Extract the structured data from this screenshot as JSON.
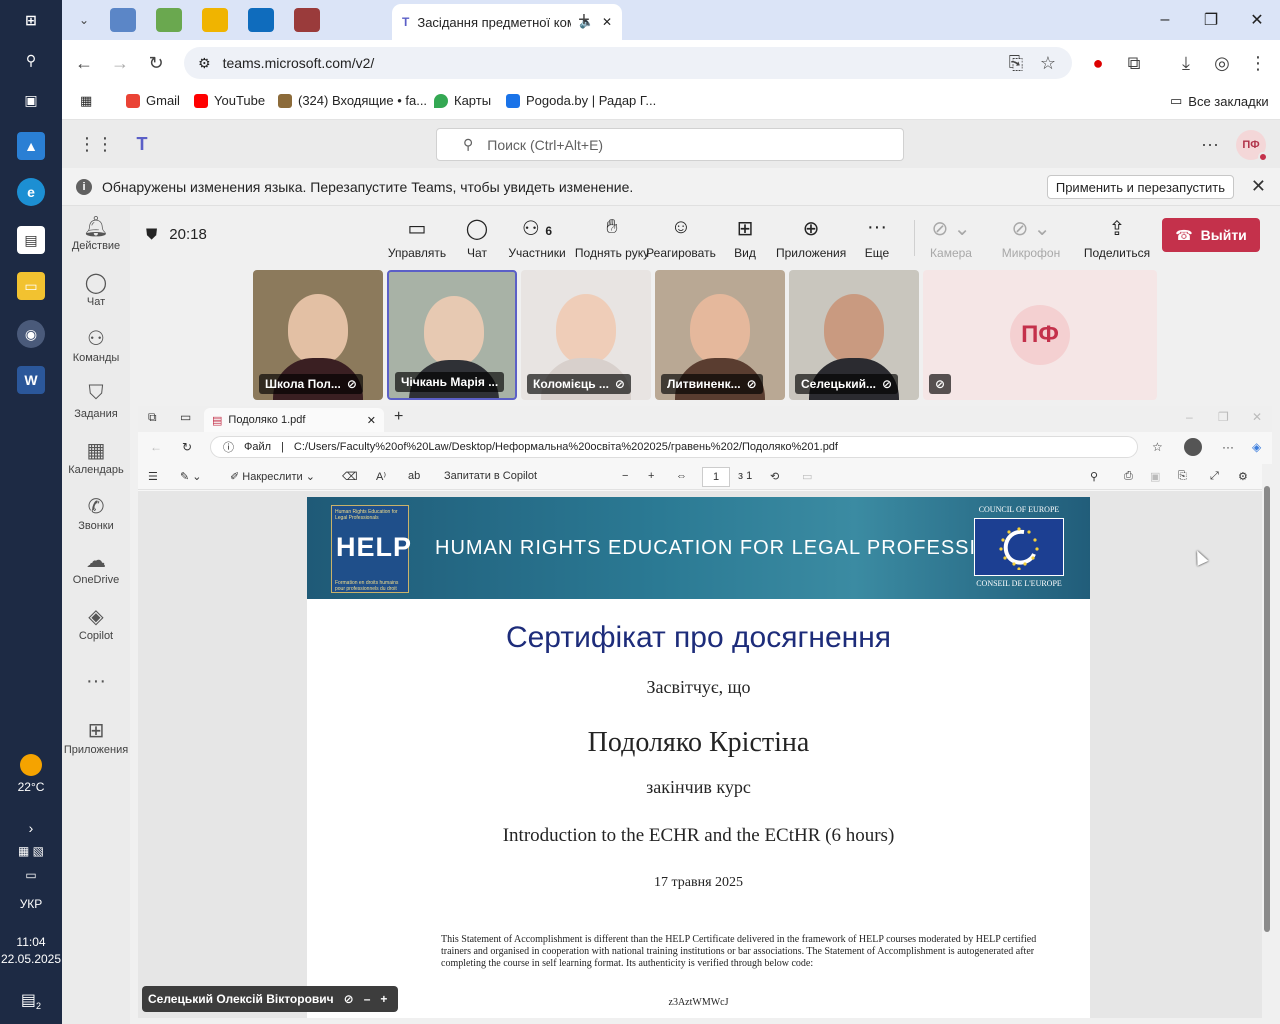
{
  "taskbar": {
    "weather_temp": "22°C",
    "language": "УКР",
    "time": "11:04",
    "date": "22.05.2025",
    "notifications_count": "2"
  },
  "chrome": {
    "active_tab_title": "Засідання предметної ком",
    "url": "teams.microsoft.com/v2/",
    "bookmarks": [
      {
        "label": "Gmail",
        "color": "#ea4335"
      },
      {
        "label": "YouTube",
        "color": "#ff0000"
      },
      {
        "label": "(324) Входящие • fa...",
        "color": "#8c6b3a"
      },
      {
        "label": "Карты",
        "color": "#34a853"
      },
      {
        "label": "Pogoda.by | Радар Г...",
        "color": "#1a73e8"
      }
    ],
    "all_bookmarks": "Все закладки"
  },
  "teams": {
    "search_placeholder": "Поиск (Ctrl+Alt+E)",
    "avatar_initials": "ПФ",
    "notice_text": "Обнаружены изменения языка. Перезапустите Teams, чтобы увидеть изменение.",
    "notice_button": "Применить и перезапустить",
    "rail": [
      "Действие",
      "Чат",
      "Команды",
      "Задания",
      "Календарь",
      "Звонки",
      "OneDrive",
      "Copilot",
      "Приложения"
    ]
  },
  "meeting": {
    "timer": "20:18",
    "controls": {
      "manage": "Управлять",
      "chat": "Чат",
      "participants": "Участники",
      "participants_count": "6",
      "raise_hand": "Поднять руку",
      "react": "Реагировать",
      "view": "Вид",
      "apps": "Приложения",
      "more": "Еще",
      "camera": "Камера",
      "mic": "Микрофон",
      "share": "Поделиться",
      "leave": "Выйти"
    },
    "participants": [
      {
        "name": "Школа Пол...",
        "bg": "#8c7a5c"
      },
      {
        "name": "Чічкань Марія ...",
        "bg": "#a8b2a6"
      },
      {
        "name": "Коломієць ...",
        "bg": "#e8e4e2"
      },
      {
        "name": "Литвиненк...",
        "bg": "#b9a894"
      },
      {
        "name": "Селецький...",
        "bg": "#c9c6be"
      }
    ],
    "avatar_tile_initials": "ПФ",
    "self_name": "Селецький Олексій Вікторович"
  },
  "pdf": {
    "tab_title": "Подоляко 1.pdf",
    "file_label": "Файл",
    "path": "C:/Users/Faculty%20of%20Law/Desktop/Неформальна%20освіта%202025/гравень%202/Подоляко%201.pdf",
    "draw_label": "Накреслити",
    "copilot_label": "Запитати в Copilot",
    "page_current": "1",
    "page_total": "з 1",
    "banner_small_top": "Human Rights Education for Legal Professionals",
    "banner_logo": "HELP",
    "banner_small_bottom": "Formation en droits humains pour professionnels du droit",
    "banner_title": "HUMAN RIGHTS EDUCATION FOR LEGAL PROFESSIONALS",
    "coe_top": "COUNCIL OF EUROPE",
    "coe_bottom": "CONSEIL DE L'EUROPE",
    "cert_title": "Сертифікат про досягнення",
    "cert_p1": "Засвітчує, що",
    "cert_name": "Подоляко Крістіна",
    "cert_p2": "закінчив курс",
    "cert_course": "Introduction to the ECHR and the ECtHR (6 hours)",
    "cert_date": "17 травня 2025",
    "cert_note": "This Statement of Accomplishment is different than the HELP Certificate delivered in the framework of HELP courses moderated by HELP certified trainers and organised in cooperation with national training institutions or bar associations. The Statement of Accomplishment is autogenerated after completing the course in self learning format. Its authenticity is verified through below code:",
    "cert_code": "z3AztWMWcJ"
  }
}
